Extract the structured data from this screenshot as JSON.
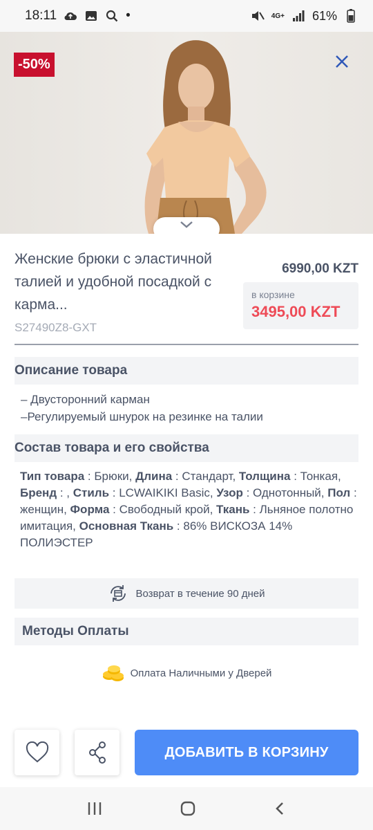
{
  "status_bar": {
    "time": "18:11",
    "dot": "•",
    "battery_percent": "61%",
    "network": "4G+"
  },
  "hero": {
    "discount_badge": "-50%"
  },
  "product": {
    "title": "Женские брюки с эластичной талией и удобной посадкой с карма...",
    "sku": "S27490Z8-GXT",
    "price_old": "6990,00 KZT",
    "cart_label": "в корзине",
    "price_new": "3495,00 KZT"
  },
  "description": {
    "heading": "Описание товара",
    "lines": [
      "– Двусторонний карман",
      "–Регулируемый шнурок на резинке на талии"
    ]
  },
  "composition": {
    "heading": "Состав товара и его свойства",
    "lines": [
      [
        {
          "k": "Тип товара",
          "v": " : Брюки, "
        },
        {
          "k": "Длина",
          "v": " : Стандарт, "
        },
        {
          "k": "Толщина",
          "v": " : Тонкая,"
        }
      ],
      [
        {
          "k": "Бренд",
          "v": " : , "
        },
        {
          "k": "Стиль",
          "v": " : LCWAIKIKI Basic, "
        },
        {
          "k": "Узор",
          "v": " : Однотонный, "
        },
        {
          "k": "Пол",
          "v": " :"
        }
      ],
      [
        {
          "k": "",
          "v": "женщин, "
        },
        {
          "k": "Форма",
          "v": " : Свободный крой, "
        },
        {
          "k": "Ткань",
          "v": " : Льняное полотно"
        }
      ],
      [
        {
          "k": "",
          "v": "имитация, "
        },
        {
          "k": "Основная Ткань",
          "v": " : 86% ВИСКОЗА 14%"
        }
      ],
      [
        {
          "k": "",
          "v": "ПОЛИЭСТЕР"
        }
      ]
    ]
  },
  "return_policy": {
    "text": "Возврат в течение 90 дней"
  },
  "payment": {
    "heading": "Методы Оплаты",
    "method": "Оплата Наличными у Дверей"
  },
  "actions": {
    "add_to_cart": "ДОБАВИТЬ В КОРЗИНУ"
  },
  "colors": {
    "accent": "#4e8cf7",
    "sale": "#ee4b57",
    "badge": "#c8102e",
    "text": "#4a5366"
  }
}
